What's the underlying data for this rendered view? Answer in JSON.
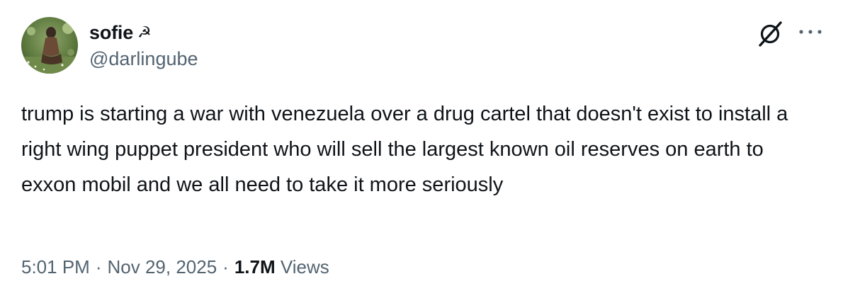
{
  "author": {
    "display_name": "sofie",
    "name_emoji": "☭",
    "handle": "@darlingube"
  },
  "tweet": {
    "text": "trump is starting a war with venezuela over a drug cartel that doesn't exist to install a right wing puppet president who will sell the largest known oil reserves on earth to exxon mobil and we all need to take it more seriously"
  },
  "meta": {
    "time": "5:01 PM",
    "separator": "·",
    "date": "Nov 29, 2025",
    "views_count": "1.7M",
    "views_label": "Views"
  },
  "icons": {
    "grok": "grok-icon",
    "more": "more-icon"
  },
  "colors": {
    "text": "#0f1419",
    "secondary": "#536471"
  }
}
